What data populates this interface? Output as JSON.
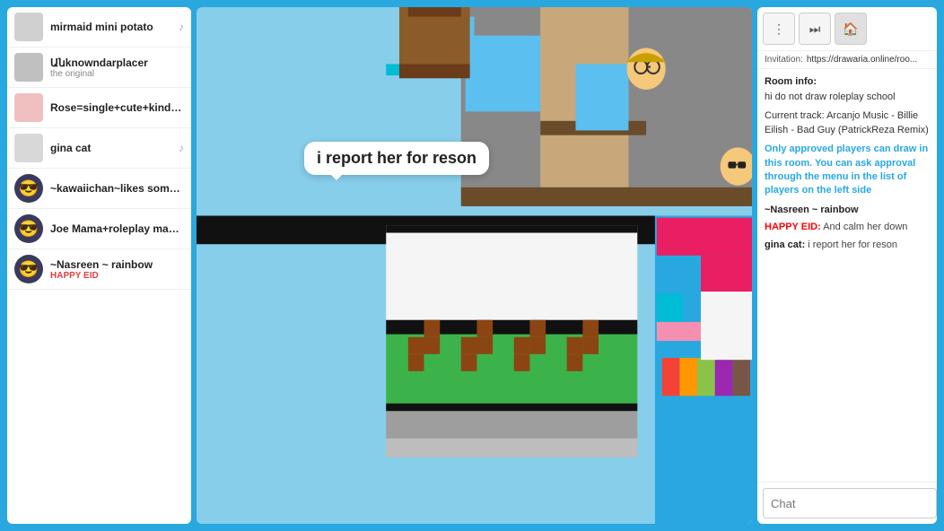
{
  "leftPanel": {
    "players": [
      {
        "name": "mirmaid mini potato",
        "sub": "",
        "hasMusic": true,
        "avatarType": "square",
        "avatarColor": "#d0d0d0",
        "emoji": ""
      },
      {
        "name": "Անknowndarplacer",
        "sub": "the original",
        "hasMusic": false,
        "avatarType": "square",
        "avatarColor": "#c0c0c0",
        "emoji": ""
      },
      {
        "name": "Rose=single+cute+kind💗",
        "sub": "",
        "hasMusic": false,
        "avatarType": "square",
        "avatarColor": "#f0c0c0",
        "emoji": ""
      },
      {
        "name": "gina cat",
        "sub": "",
        "hasMusic": true,
        "avatarType": "square",
        "avatarColor": "#d8d8d8",
        "emoji": ""
      },
      {
        "name": "~kawaiichan~likes someone~",
        "sub": "",
        "hasMusic": false,
        "avatarType": "emoji",
        "avatarColor": "#ffd700",
        "emoji": "😎"
      },
      {
        "name": "Joe Mama+roleplay master",
        "sub": "",
        "hasMusic": false,
        "avatarType": "emoji",
        "avatarColor": "#ffd700",
        "emoji": "😎"
      },
      {
        "name": "~Nasreen ~ rainbow",
        "sub": "HAPPY EID",
        "hasMusic": false,
        "avatarType": "emoji",
        "avatarColor": "#ffd700",
        "emoji": "😎"
      }
    ]
  },
  "speechBubble": {
    "text": "i report her for reson"
  },
  "rightPanel": {
    "invitation": {
      "label": "Invitation:",
      "url": "https://drawaria.online/roo..."
    },
    "roomInfo": {
      "title": "Room info:",
      "description": "hi do not draw roleplay school",
      "currentTrack": "Current track: Arcanjo Music - Billie Eilish - Bad Guy (PatrickReza Remix)",
      "approvedOnly": "Only approved players can draw in this room. You can ask approval through the menu in the list of players on the left side"
    },
    "messages": [
      {
        "username": "~Nasreen ~ rainbow",
        "usernameColor": "#222",
        "text": ""
      },
      {
        "username": "HAPPY EID:",
        "usernameColor": "red",
        "text": "  And calm her down"
      },
      {
        "username": "gina cat:",
        "usernameColor": "#222",
        "text": "  i report her for reson"
      }
    ],
    "chatPlaceholder": "Chat",
    "buttons": {
      "more": "⋮",
      "fastForward": "⏭",
      "home": "🏠"
    }
  }
}
